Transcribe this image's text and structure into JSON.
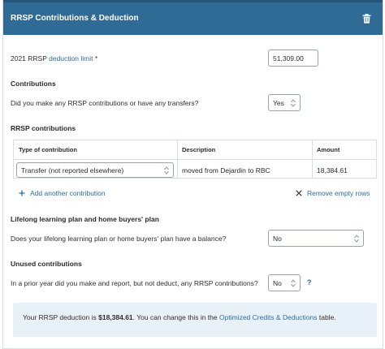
{
  "header": {
    "title": "RRSP Contributions & Deduction"
  },
  "deduction_limit": {
    "prefix": "2021 RRSP",
    "link": "deduction limit",
    "required": "*",
    "value": "51,309.00"
  },
  "contributions": {
    "heading": "Contributions",
    "question": "Did you make any RRSP contributions or have any transfers?",
    "answer": "Yes"
  },
  "rrsp_contributions": {
    "heading": "RRSP contributions",
    "columns": [
      "Type of contribution",
      "Description",
      "Amount"
    ],
    "rows": [
      {
        "type": "Transfer (not reported elsewhere)",
        "description": "moved from Dejardin to RBC",
        "amount": "18,384.61"
      }
    ],
    "add_link": "Add another contribution",
    "remove_link": "Remove empty rows"
  },
  "llp_hbp": {
    "heading": "Lifelong learning plan and home buyers' plan",
    "question": "Does your lifelong learning plan or home buyers' plan have a balance?",
    "answer": "No"
  },
  "unused": {
    "heading": "Unused contributions",
    "question": "In a prior year did you make and report, but not deduct, any RRSP contributions?",
    "answer": "No",
    "help": "?"
  },
  "summary": {
    "before": "Your RRSP deduction is",
    "amount": "$18,384.61",
    "middle": ". You can change this in the",
    "link": "Optimized Credits & Deductions",
    "after": "table."
  },
  "colors": {
    "header": "#2f6b94",
    "link": "#2b6d9e",
    "info_bg": "#e9f1f8"
  }
}
